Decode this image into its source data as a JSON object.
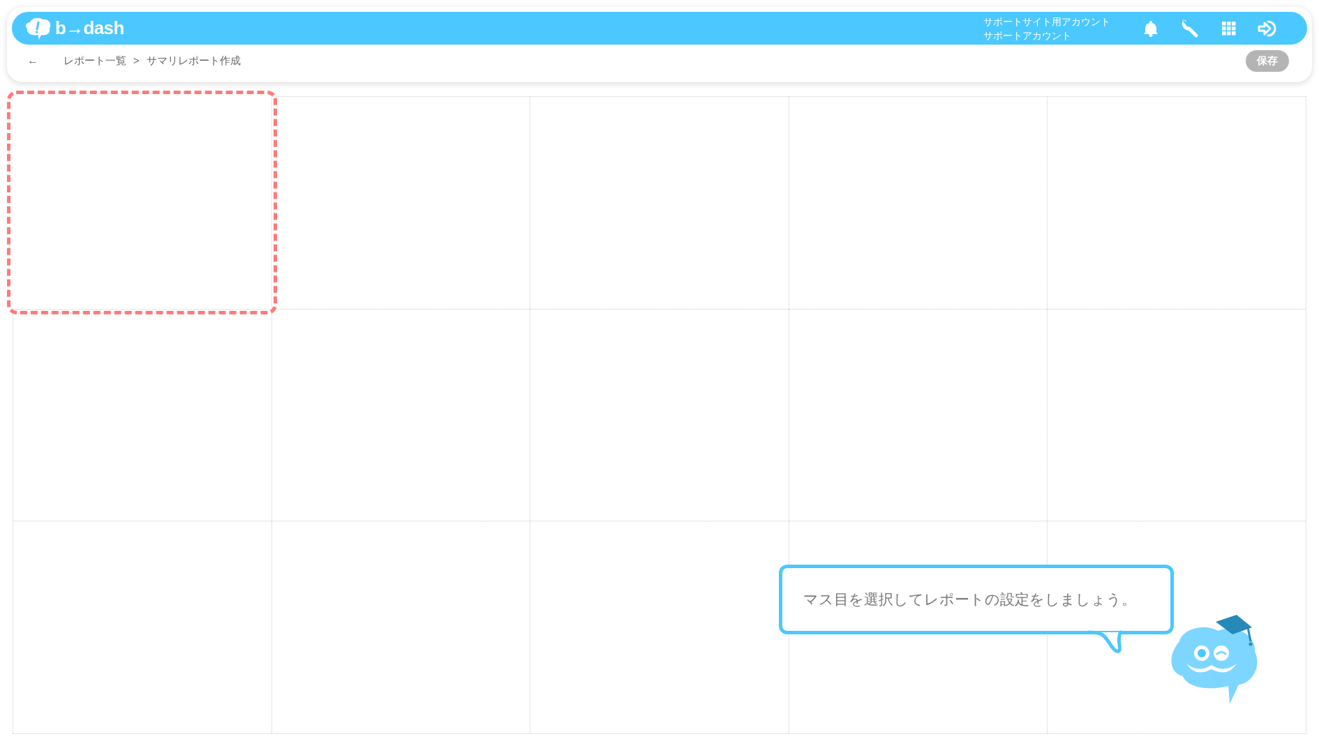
{
  "header": {
    "logo": "b→dash",
    "account_lines": [
      "サポートサイト用アカウント",
      "サポートアカウント"
    ]
  },
  "breadcrumb": {
    "back": "←",
    "items": [
      "レポート一覧",
      "サマリレポート作成"
    ],
    "separator": ">"
  },
  "save_button": {
    "label": "保存",
    "disabled": true
  },
  "grid": {
    "cells": [
      {
        "selected": true
      },
      {
        "selected": false
      },
      {
        "selected": false
      },
      {
        "selected": false
      },
      {
        "selected": false
      },
      {
        "selected": false
      },
      {
        "selected": false
      },
      {
        "selected": false
      },
      {
        "selected": false
      },
      {
        "selected": false
      },
      {
        "selected": false
      },
      {
        "selected": false
      },
      {
        "selected": false
      },
      {
        "selected": false
      },
      {
        "selected": false
      }
    ]
  },
  "guide": {
    "message": "マス目を選択してレポートの設定をしましょう。"
  }
}
